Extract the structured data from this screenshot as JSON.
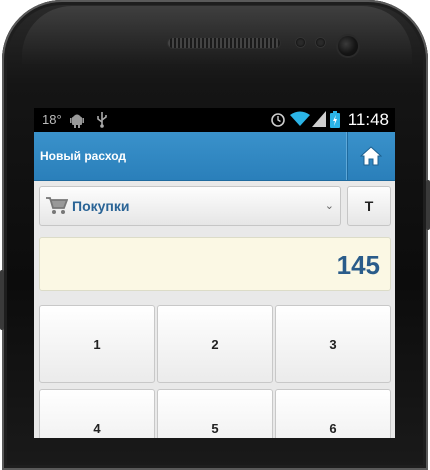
{
  "statusbar": {
    "temperature": "18°",
    "time": "11:48"
  },
  "appbar": {
    "title": "Новый расход",
    "home_icon": "home-icon"
  },
  "category": {
    "selected": "Покупки",
    "icon": "cart-icon"
  },
  "type_button": {
    "label": "T"
  },
  "amount": {
    "value": "145"
  },
  "keypad": {
    "keys": [
      "1",
      "2",
      "3",
      "4",
      "5",
      "6"
    ]
  },
  "colors": {
    "accent": "#2a83bf",
    "amount_bg": "#fbf8e4",
    "amount_text": "#2a5c8a"
  }
}
